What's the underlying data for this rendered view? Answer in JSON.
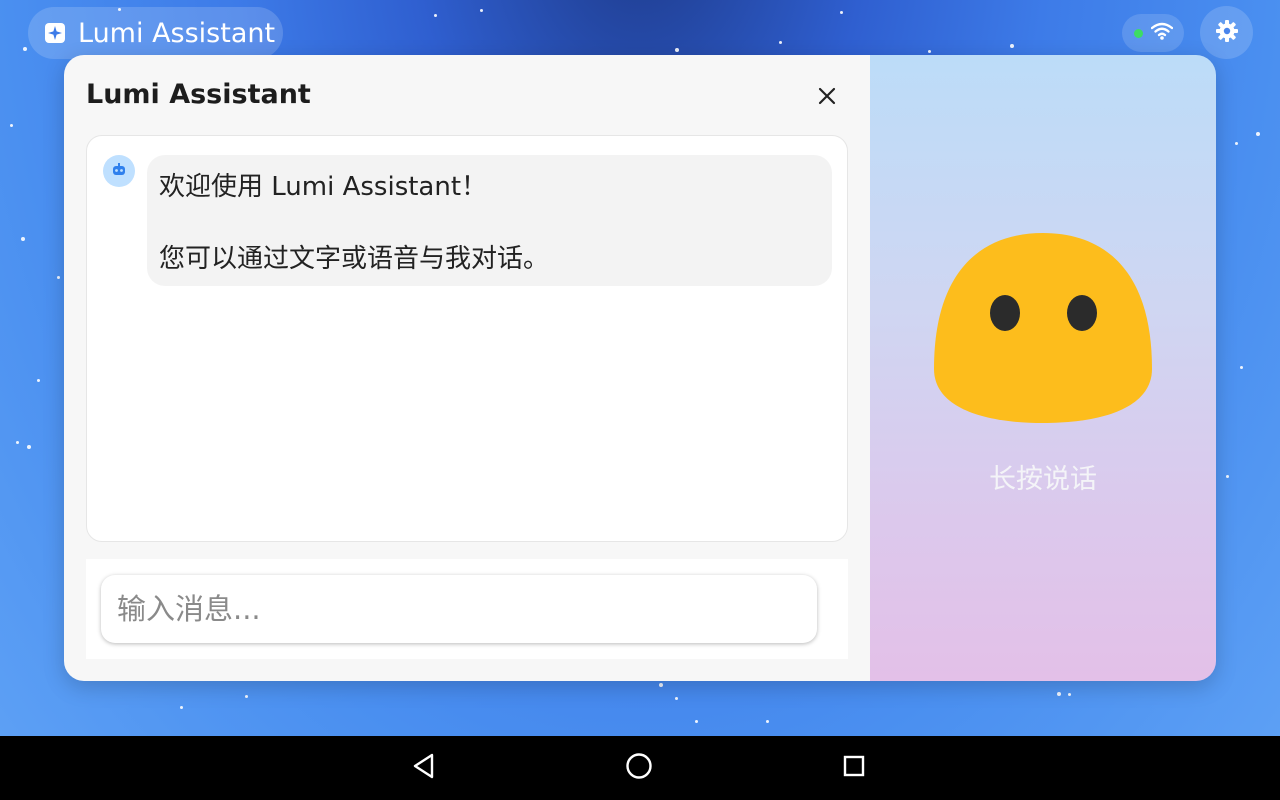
{
  "topbar": {
    "app_title": "Lumi Assistant",
    "app_icon": "sparkle-icon",
    "status_icon": "wifi-icon",
    "status_color": "#3ddc64",
    "settings_icon": "gear-icon"
  },
  "dialog": {
    "title": "Lumi Assistant",
    "close_icon": "close-icon",
    "messages": [
      {
        "sender": "bot",
        "avatar_icon": "robot-icon",
        "line1": "欢迎使用 Lumi Assistant！",
        "line2": "您可以通过文字或语音与我对话。"
      }
    ],
    "input": {
      "placeholder": "输入消息...",
      "value": ""
    }
  },
  "voice": {
    "mascot_color": "#fdbd1c",
    "hold_label": "长按说话"
  },
  "navbar": {
    "back_icon": "back-triangle-icon",
    "home_icon": "home-circle-icon",
    "recents_icon": "recents-square-icon"
  }
}
